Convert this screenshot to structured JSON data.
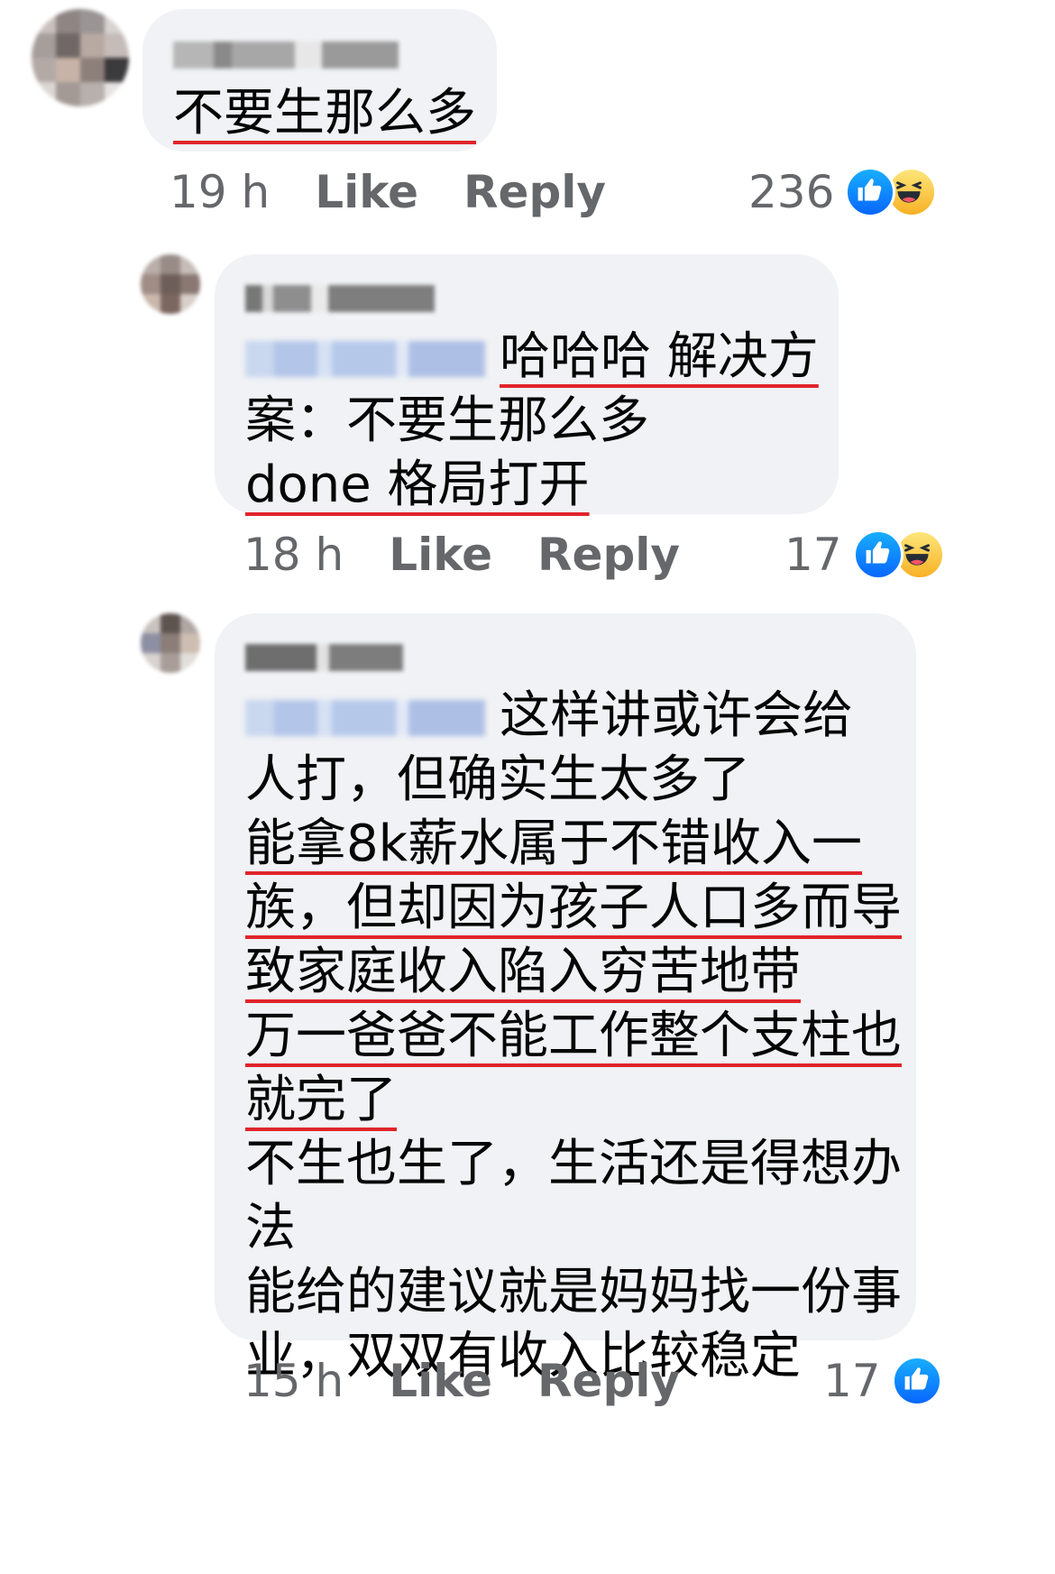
{
  "comments": [
    {
      "lines": [
        {
          "text": "不要生那么多",
          "underline": true
        }
      ],
      "time": "19 h",
      "like_label": "Like",
      "reply_label": "Reply",
      "reaction_count": "236",
      "reactions": [
        "like-icon",
        "haha-icon"
      ]
    },
    {
      "mention_line_text": "哈哈哈 解决方",
      "lines": [
        {
          "text": "案：不要生那么多",
          "underline": false
        },
        {
          "text": "done 格局打开",
          "underline": true
        }
      ],
      "time": "18 h",
      "like_label": "Like",
      "reply_label": "Reply",
      "reaction_count": "17",
      "reactions": [
        "like-icon",
        "haha-icon"
      ]
    },
    {
      "mention_line_text": "这样讲或许会给",
      "lines": [
        {
          "text": "人打，但确实生太多了",
          "underline": false
        },
        {
          "text": "能拿8k薪水属于不错收入一",
          "underline": true
        },
        {
          "text": "族，但却因为孩子人口多而导",
          "underline": true
        },
        {
          "text": "致家庭收入陷入穷苦地带",
          "underline": true
        },
        {
          "text": "万一爸爸不能工作整个支柱也",
          "underline": true
        },
        {
          "text": "就完了",
          "underline": true
        },
        {
          "text": "不生也生了，生活还是得想办",
          "underline": false
        },
        {
          "text": "法",
          "underline": false
        },
        {
          "text": "能给的建议就是妈妈找一份事",
          "underline": false
        },
        {
          "text": "业，双双有收入比较稳定",
          "underline": false
        }
      ],
      "time": "15 h",
      "like_label": "Like",
      "reply_label": "Reply",
      "reaction_count": "17",
      "reactions": [
        "like-icon"
      ]
    }
  ],
  "colors": {
    "bubble": "#f0f2f5",
    "meta_text": "#65676b",
    "underline": "#e0242b",
    "like_blue": "#0866ff",
    "haha_yellow": "#f7b125"
  }
}
